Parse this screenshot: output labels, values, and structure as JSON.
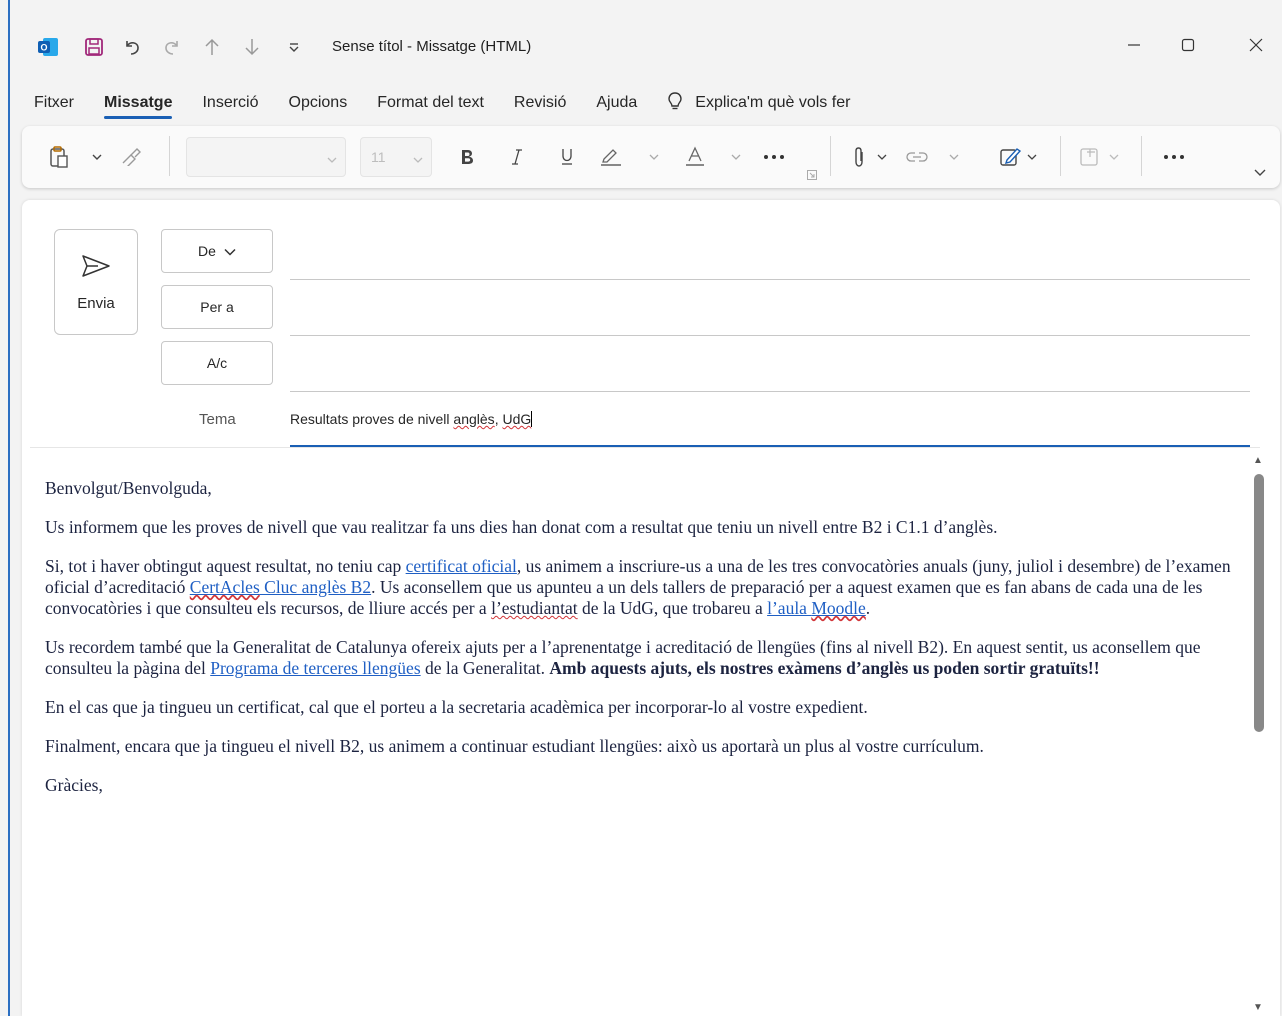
{
  "window": {
    "title": "Sense títol  -  Missatge (HTML)",
    "accent": "#1a5fb4"
  },
  "menu": {
    "items": [
      "Fitxer",
      "Missatge",
      "Inserció",
      "Opcions",
      "Format del text",
      "Revisió",
      "Ajuda"
    ],
    "active": "Missatge",
    "tell_me": "Explica'm què vols fer"
  },
  "ribbon": {
    "font_size": "11"
  },
  "compose": {
    "send_label": "Envia",
    "from_label": "De",
    "to_label": "Per a",
    "cc_label": "A/c",
    "subject_label": "Tema",
    "subject_prefix": "Resultats proves de nivell ",
    "subject_word1": "anglès",
    "subject_sep": ", ",
    "subject_word2": "UdG"
  },
  "body": {
    "greeting": "Benvolgut/Benvolguda,",
    "p1": "Us informem que les proves de nivell que vau realitzar fa uns dies han donat com a resultat que teniu un nivell entre B2 i C1.1 d’anglès.",
    "p2_a": "Si, tot i haver obtingut aquest resultat, no teniu cap ",
    "p2_link1": "certificat oficial",
    "p2_b": ", us animem a inscriure-us a una de les tres convocatòries anuals (juny, juliol i desembre) de l’examen oficial d’acreditació ",
    "p2_link2_a": "CertAcles",
    "p2_link2_b": " Cluc anglès B2",
    "p2_c": ". Us aconsellem que us apunteu a un dels tallers de preparació per a aquest examen que es fan abans de cada una de les convocatòries i que consulteu els recursos, de lliure accés per a ",
    "p2_d": "l’estudiantat",
    "p2_e": " de la UdG, que trobareu a ",
    "p2_link3_a": "l’aula ",
    "p2_link3_b": "Moodle",
    "p2_f": ".",
    "p3_a": "Us recordem també que la Generalitat de Catalunya ofereix ajuts per a l’aprenentatge i acreditació de llengües (fins al nivell B2). En aquest sentit, us aconsellem que consulteu la pàgina del ",
    "p3_link": "Programa de terceres llengües",
    "p3_b": " de la Generalitat. ",
    "p3_bold": "Amb aquests ajuts, els nostres exàmens d’anglès us poden sortir gratuïts!!",
    "p4": "En el cas que ja tingueu un certificat, cal que el porteu a la secretaria acadèmica per incorporar-lo al vostre expedient.",
    "p5": "Finalment, encara que ja tingueu el nivell B2, us animem a continuar estudiant llengües: això us aportarà un plus al vostre currículum.",
    "closing": "Gràcies,"
  }
}
